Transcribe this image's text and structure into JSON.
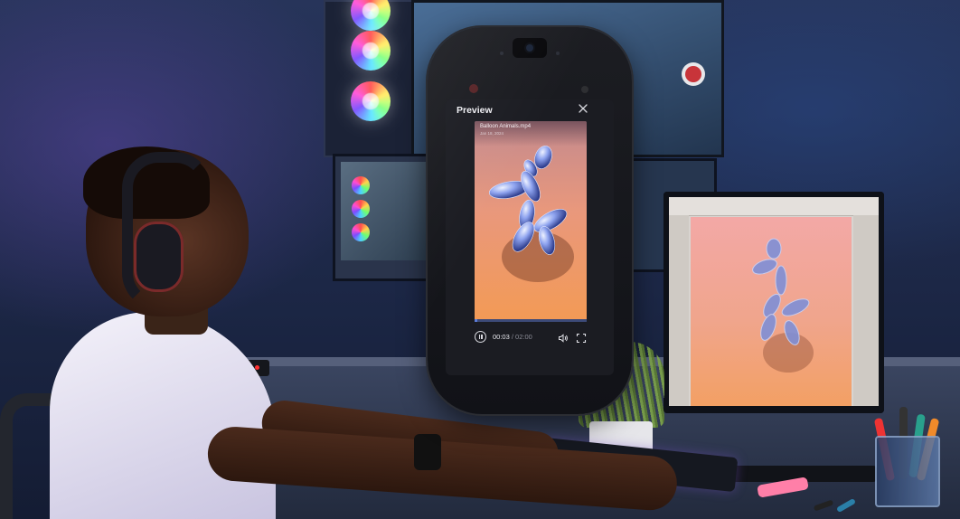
{
  "preview": {
    "title": "Preview",
    "file_name": "Balloon Animals.mp4",
    "file_date": "Jan 18, 2024",
    "current_time": "00:03",
    "separator": " / ",
    "duration": "02:00",
    "progress": 0.025
  },
  "colors": {
    "accent": "#5b7bd6",
    "dialog_bg": "#1b1c22",
    "video_gradient_top": "#c48a8e",
    "video_gradient_bottom": "#f39a55"
  },
  "icons": {
    "close": "close-icon",
    "pause": "pause-icon",
    "volume": "volume-icon",
    "fullscreen": "fullscreen-icon"
  }
}
